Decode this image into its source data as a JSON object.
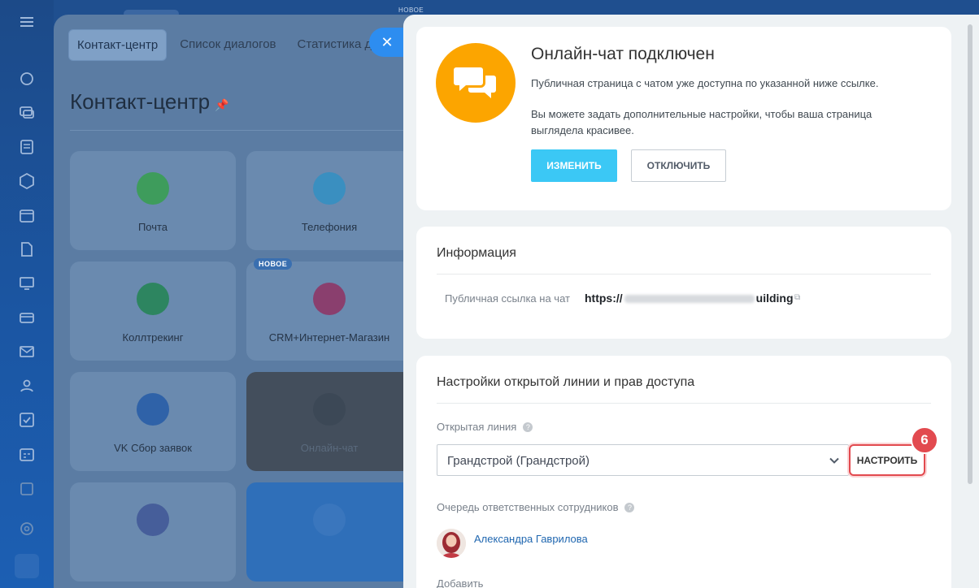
{
  "background": {
    "tabs": [
      "Контакт-центр",
      "Список диалогов",
      "Статистика ди"
    ],
    "title": "Контакт-центр",
    "new_badge": "НОВОЕ",
    "top_new": "НОВОЕ",
    "tiles": [
      "Почта",
      "Телефония",
      "Коллтрекинг",
      "CRM+Интернет-Магазин",
      "VK Сбор заявок",
      "Онлайн-чат"
    ]
  },
  "close_icon": "✕",
  "status_card": {
    "title": "Онлайн-чат подключен",
    "text1": "Публичная страница с чатом уже доступна по указанной ниже ссылке.",
    "text2": "Вы можете задать дополнительные настройки, чтобы ваша страница выглядела красивее.",
    "edit_label": "ИЗМЕНИТЬ",
    "disable_label": "ОТКЛЮЧИТЬ",
    "accent": "#fca500"
  },
  "info_card": {
    "title": "Информация",
    "link_label": "Публичная ссылка на чат",
    "link_prefix": "https://",
    "link_suffix": "uilding"
  },
  "settings_card": {
    "title": "Настройки открытой линии и прав доступа",
    "open_line_label": "Открытая линия",
    "open_line_value": "Грандстрой (Грандстрой)",
    "configure_label": "НАСТРОИТЬ",
    "step_badge": "6",
    "queue_label": "Очередь ответственных сотрудников",
    "employee": "Александра Гаврилова",
    "add_label": "Добавить",
    "help_glyph": "?"
  }
}
